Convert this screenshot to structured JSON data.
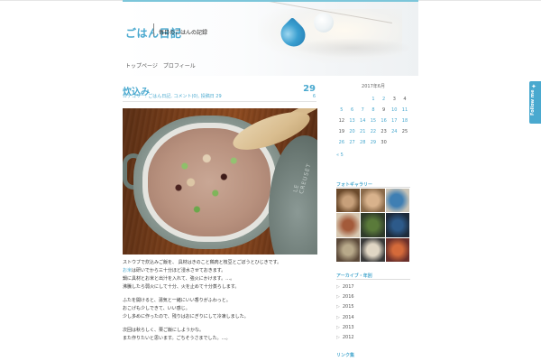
{
  "header": {
    "site_title": "ごはん日記",
    "site_description": "毎日のごはんの記録",
    "nav": [
      "トップページ",
      "プロフィール"
    ]
  },
  "post": {
    "title": "炊込み",
    "meta": "カテゴリー: ごはん日記, コメント(0), 投稿日 29",
    "day": "29",
    "month": "6",
    "photo_label": "LE CREUSET",
    "paragraphs": [
      [
        "ストウブで炊込みご飯を、 具材はきのこと鶏肉と枝豆とごぼうとひじきです。",
        "",
        ""
      ],
      [
        "",
        "お米",
        "は研いでから三十分ほど浸水させておきます。"
      ],
      [
        "鍋に具材とお米と出汁を入れて、強火にかけます。…。",
        "",
        ""
      ],
      [
        "沸騰したら弱火にして十分、火を止めて十分蒸らします。",
        "",
        ""
      ],
      [
        "ふたを開けると、湯気と一緒にいい香りがふわっと。",
        "",
        ""
      ],
      [
        "おこげも少しできて、いい感じ。",
        "",
        ""
      ],
      [
        "少し多めに作ったので、残りはおにぎりにして冷凍しました。",
        "",
        ""
      ],
      [
        "次回は秋らしく、栗ご飯にしようかな。",
        "",
        ""
      ],
      [
        "また作りたいと思います。ごちそうさまでした。…。",
        "",
        ""
      ]
    ]
  },
  "calendar": {
    "caption": "2017年6月",
    "weeks": [
      [
        "",
        "",
        "",
        "1",
        "2",
        "3",
        "4"
      ],
      [
        "5",
        "6",
        "7",
        "8",
        "9",
        "10",
        "11"
      ],
      [
        "12",
        "13",
        "14",
        "15",
        "16",
        "17",
        "18"
      ],
      [
        "19",
        "20",
        "21",
        "22",
        "23",
        "24",
        "25"
      ],
      [
        "26",
        "27",
        "28",
        "29",
        "30",
        "",
        ""
      ]
    ],
    "linked_days": [
      "1",
      "2",
      "5",
      "6",
      "7",
      "8",
      "10",
      "11",
      "13",
      "14",
      "15",
      "16",
      "17",
      "18",
      "20",
      "21",
      "22",
      "24",
      "26",
      "27",
      "28",
      "29"
    ],
    "prev_link": "« 5"
  },
  "widgets": {
    "photo_title": "フォトギャラリー",
    "archive_title": "アーカイブ・年別",
    "archive_items": [
      "2017",
      "2016",
      "2015",
      "2014",
      "2013",
      "2012"
    ],
    "links_title": "リンク集"
  },
  "colors": {
    "accent": "#4aa9cf"
  },
  "follow": {
    "label": "Follow me"
  }
}
